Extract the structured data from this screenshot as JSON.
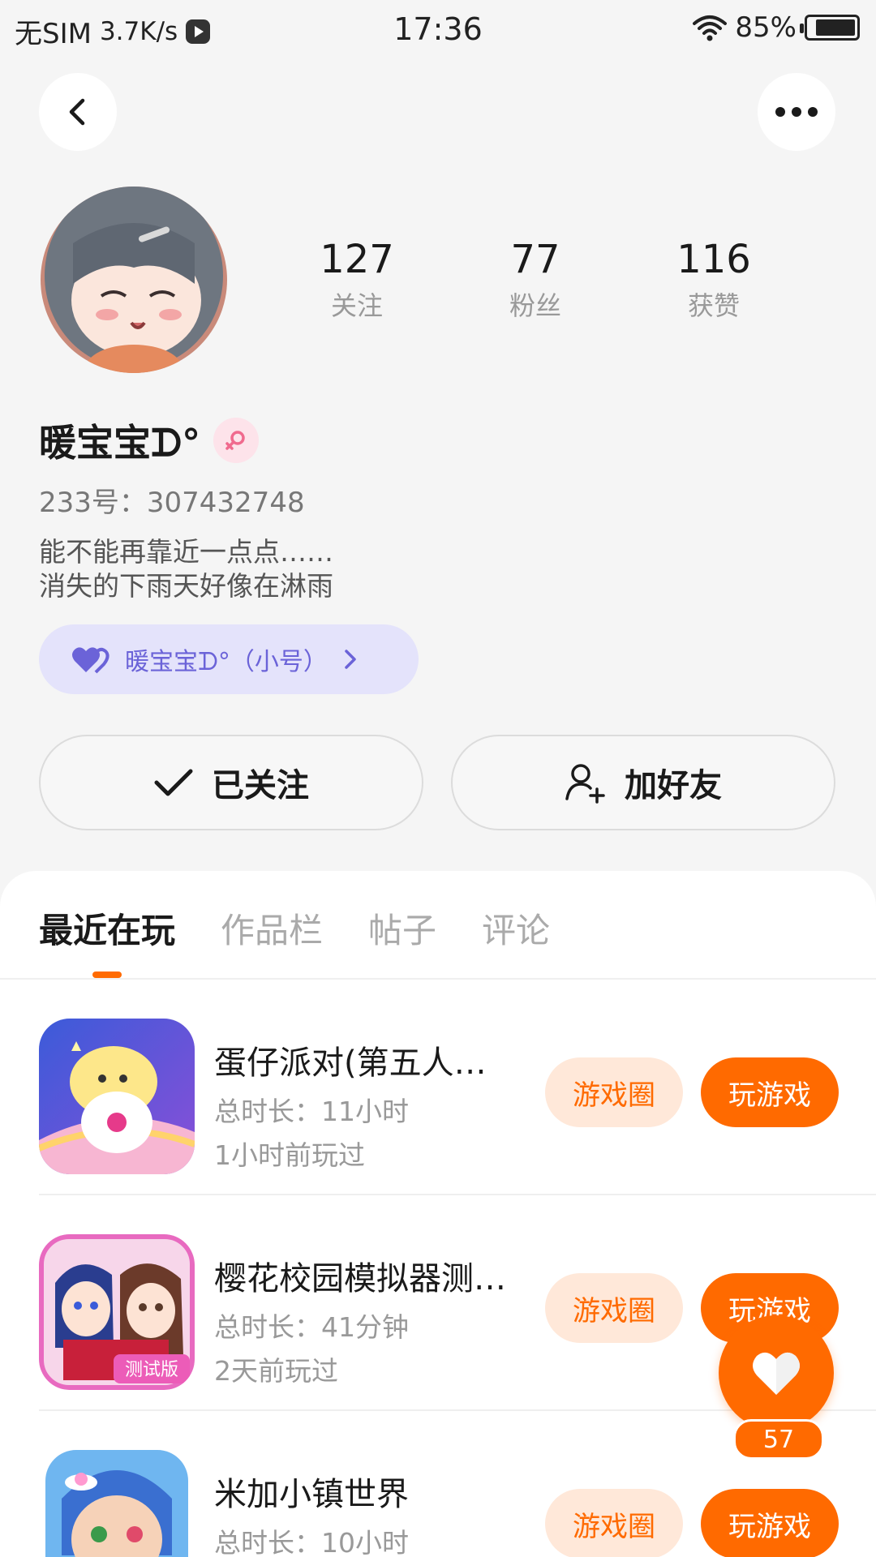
{
  "status_bar": {
    "carrier": "无SIM",
    "speed": "3.7K/s",
    "time": "17:36",
    "battery": "85%",
    "battery_level": 0.85
  },
  "profile": {
    "stats": [
      {
        "value": "127",
        "label": "关注"
      },
      {
        "value": "77",
        "label": "粉丝"
      },
      {
        "value": "116",
        "label": "获赞"
      }
    ],
    "name": "暖宝宝ᗪ°",
    "uid": "233号：307432748",
    "bio": "能不能再靠近一点点……\n消失的下雨天好像在淋雨",
    "alt_account": "暖宝宝ᗪ°（小号）"
  },
  "actions": {
    "follow_label": "已关注",
    "add_friend_label": "加好友"
  },
  "tabs": [
    "最近在玩",
    "作品栏",
    "帖子",
    "评论"
  ],
  "games": [
    {
      "title": "蛋仔派对(第五人…",
      "total": "总时长：11小时",
      "last": "1小时前玩过",
      "circle_label": "游戏圈",
      "play_label": "玩游戏"
    },
    {
      "title": "樱花校园模拟器测…",
      "total": "总时长：41分钟",
      "last": "2天前玩过",
      "circle_label": "游戏圈",
      "play_label": "玩游戏",
      "icon_badge": "测试版"
    },
    {
      "title": "米加小镇世界",
      "total": "总时长：10小时",
      "last": "",
      "circle_label": "游戏圈",
      "play_label": "玩游戏"
    }
  ],
  "like": {
    "count": "57"
  },
  "colors": {
    "accent": "#ff6a00",
    "accent_light": "#ffe8d9",
    "alt_account_bg": "#e4e3fb",
    "alt_account_text": "#6b63d8"
  }
}
